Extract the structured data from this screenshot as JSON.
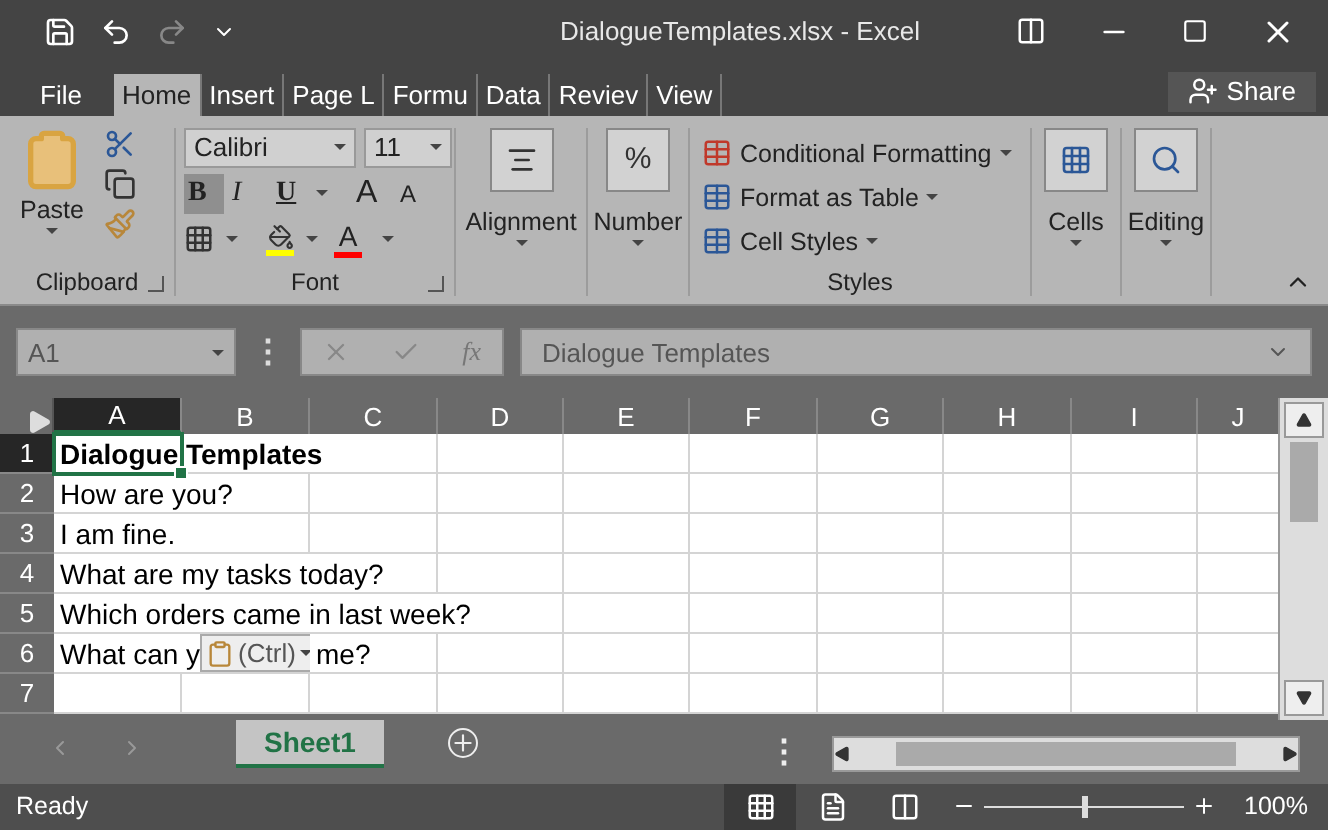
{
  "window": {
    "title": "DialogueTemplates.xlsx - Excel"
  },
  "menu_tabs": [
    {
      "label": "File",
      "selected": false
    },
    {
      "label": "Home",
      "selected": true
    },
    {
      "label": "Insert",
      "selected": false
    },
    {
      "label": "Page L",
      "selected": false
    },
    {
      "label": "Formu",
      "selected": false
    },
    {
      "label": "Data",
      "selected": false
    },
    {
      "label": "Reviev",
      "selected": false
    },
    {
      "label": "View",
      "selected": false
    }
  ],
  "share": "Share",
  "ribbon": {
    "clipboard": {
      "paste": "Paste",
      "label": "Clipboard"
    },
    "font": {
      "name": "Calibri",
      "size": "11",
      "bold": "B",
      "italic": "I",
      "underline": "U",
      "grow": "A",
      "shrink": "A",
      "color_letter": "A",
      "label": "Font",
      "bold_pressed": true
    },
    "alignment": "Alignment",
    "number": {
      "symbol": "%",
      "label": "Number"
    },
    "styles": {
      "items": [
        "Conditional Formatting",
        "Format as Table",
        "Cell Styles"
      ],
      "label": "Styles"
    },
    "cells": "Cells",
    "editing": "Editing"
  },
  "formula_bar": {
    "more": "⋮",
    "name_box": "A1",
    "function_symbol": "fx",
    "formula": "Dialogue Templates"
  },
  "columns": [
    {
      "label": "A",
      "selected": true
    },
    {
      "label": "B",
      "selected": false
    },
    {
      "label": "C",
      "selected": false
    },
    {
      "label": "D",
      "selected": false
    },
    {
      "label": "E",
      "selected": false
    },
    {
      "label": "F",
      "selected": false
    },
    {
      "label": "G",
      "selected": false
    },
    {
      "label": "H",
      "selected": false
    },
    {
      "label": "I",
      "selected": false
    },
    {
      "label": "J",
      "selected": false
    }
  ],
  "rows": [
    {
      "number": "1",
      "text": "Dialogue Templates",
      "bold": true,
      "selected": true
    },
    {
      "number": "2",
      "text": "How are you?",
      "bold": false,
      "selected": false
    },
    {
      "number": "3",
      "text": "I am fine.",
      "bold": false,
      "selected": false
    },
    {
      "number": "4",
      "text": "What are my tasks today?",
      "bold": false,
      "selected": false
    },
    {
      "number": "5",
      "text": "Which orders came in last week?",
      "bold": false,
      "selected": false
    },
    {
      "number": "6",
      "text": "What can y",
      "text_after_popup": "me?",
      "popup": "(Ctrl)",
      "bold": false,
      "selected": false
    },
    {
      "number": "7",
      "selected": false
    }
  ],
  "sheet_tabs": [
    {
      "label": "Sheet1",
      "selected": true
    }
  ],
  "sheet_more": "⋮",
  "status_bar": {
    "status": "Ready",
    "zoom_slider": {
      "level": 0.5
    },
    "zoom": "100%"
  }
}
